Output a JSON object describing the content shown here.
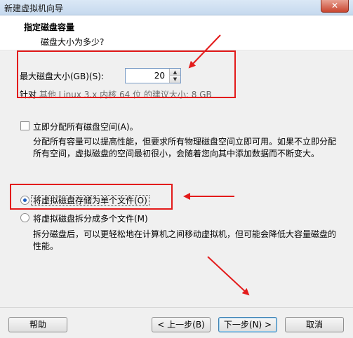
{
  "window": {
    "title": "新建虚拟机向导",
    "close_glyph": "✕"
  },
  "header": {
    "title": "指定磁盘容量",
    "subtitle": "磁盘大小为多少?"
  },
  "disk": {
    "size_label": "最大磁盘大小(GB)(S):",
    "size_value": "20",
    "recommendation_prefix": "针对 ",
    "recommendation_os": "其他 Linux 3.x 内核 64 位 的建议大小: 8 GB"
  },
  "allocate": {
    "label": "立即分配所有磁盘空间(A)。",
    "checked": false,
    "description": "分配所有容量可以提高性能，但要求所有物理磁盘空间立即可用。如果不立即分配所有空间，虚拟磁盘的空间最初很小，会随着您向其中添加数据而不断变大。"
  },
  "storage": {
    "single_label": "将虚拟磁盘存储为单个文件(O)",
    "single_selected": true,
    "multi_label": "将虚拟磁盘拆分成多个文件(M)",
    "multi_selected": false,
    "multi_description": "拆分磁盘后，可以更轻松地在计算机之间移动虚拟机，但可能会降低大容量磁盘的性能。"
  },
  "footer": {
    "help_label": "帮助",
    "back_label": "< 上一步(B)",
    "next_label": "下一步(N) >",
    "cancel_label": "取消"
  },
  "annotation": {
    "color": "#e31b1b"
  }
}
